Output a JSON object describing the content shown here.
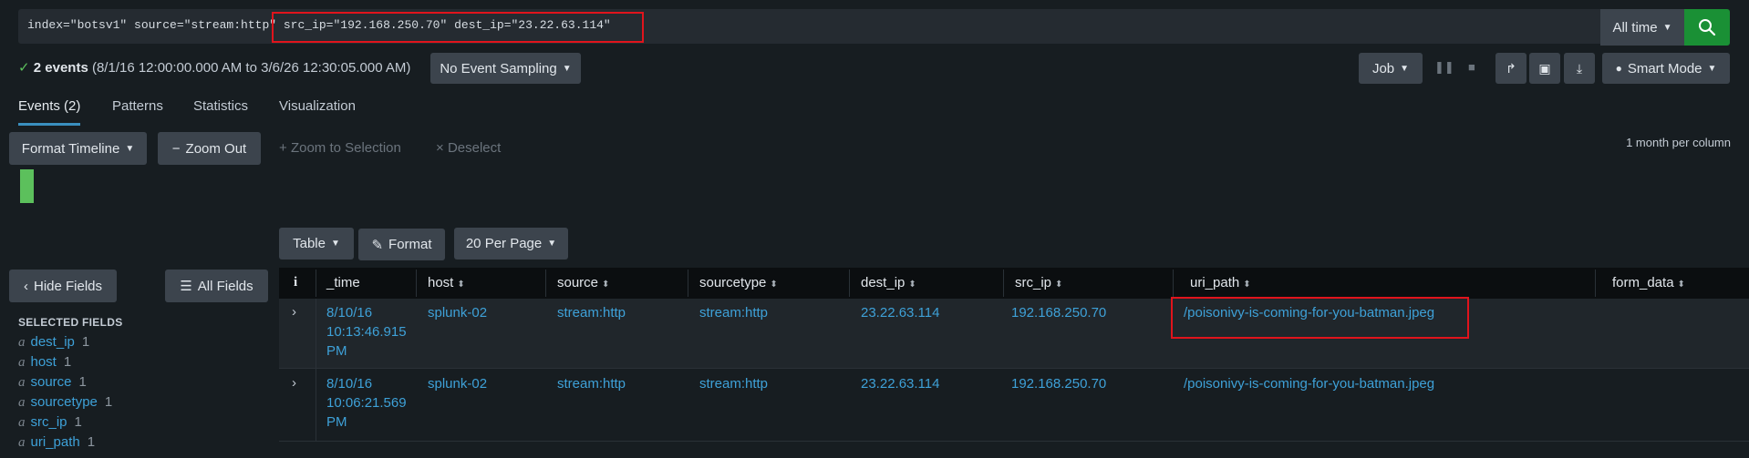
{
  "search": {
    "query_prefix": "index=\"botsv1\" source=\"stream:http\" ",
    "query_highlight": "src_ip=\"192.168.250.70\" dest_ip=\"23.22.63.114\"",
    "time_range": "All time",
    "search_icon": "search-icon"
  },
  "status": {
    "check": "✓",
    "count": "2 events",
    "range": "(8/1/16 12:00:00.000 AM to 3/6/26 12:30:05.000 AM)",
    "sampling": "No Event Sampling",
    "job": "Job",
    "mode": "Smart Mode"
  },
  "tabs": [
    {
      "label": "Events (2)"
    },
    {
      "label": "Patterns"
    },
    {
      "label": "Statistics"
    },
    {
      "label": "Visualization"
    }
  ],
  "timeline": {
    "format": "Format Timeline",
    "zoom_out": "Zoom Out",
    "zoom_selection": "Zoom to Selection",
    "deselect": "Deselect",
    "scale": "1 month per column",
    "bar_color": "#5cc05c"
  },
  "table_controls": {
    "table": "Table",
    "format": "Format",
    "per_page": "20 Per Page"
  },
  "sidebar": {
    "hide_fields": "Hide Fields",
    "all_fields": "All Fields",
    "selected_title": "SELECTED FIELDS",
    "fields": [
      {
        "type": "a",
        "name": "dest_ip",
        "count": "1"
      },
      {
        "type": "a",
        "name": "host",
        "count": "1"
      },
      {
        "type": "a",
        "name": "source",
        "count": "1"
      },
      {
        "type": "a",
        "name": "sourcetype",
        "count": "1"
      },
      {
        "type": "a",
        "name": "src_ip",
        "count": "1"
      },
      {
        "type": "a",
        "name": "uri_path",
        "count": "1"
      }
    ]
  },
  "table": {
    "info_header": "i",
    "columns": [
      "_time",
      "host",
      "source",
      "sourcetype",
      "dest_ip",
      "src_ip",
      "uri_path",
      "form_data"
    ],
    "rows": [
      {
        "time1": "8/10/16",
        "time2": "10:13:46.915",
        "time3": "PM",
        "host": "splunk-02",
        "source": "stream:http",
        "sourcetype": "stream:http",
        "dest_ip": "23.22.63.114",
        "src_ip": "192.168.250.70",
        "uri_path": "/poisonivy-is-coming-for-you-batman.jpeg",
        "form_data": ""
      },
      {
        "time1": "8/10/16",
        "time2": "10:06:21.569",
        "time3": "PM",
        "host": "splunk-02",
        "source": "stream:http",
        "sourcetype": "stream:http",
        "dest_ip": "23.22.63.114",
        "src_ip": "192.168.250.70",
        "uri_path": "/poisonivy-is-coming-for-you-batman.jpeg",
        "form_data": ""
      }
    ]
  },
  "colors": {
    "accent": "#3ea1d8",
    "highlight_border": "#e0141c",
    "search_button": "#1a9035"
  }
}
